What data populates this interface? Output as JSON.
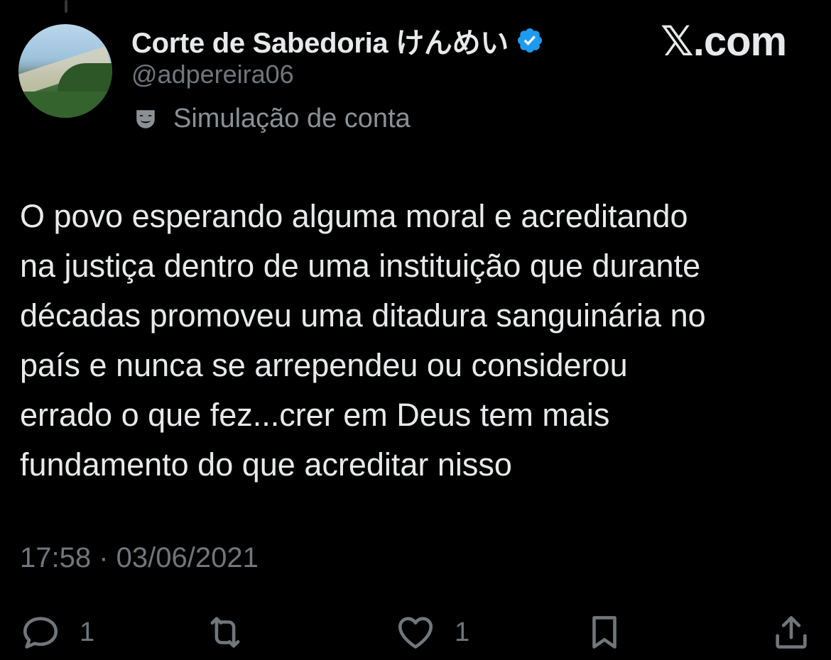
{
  "author": {
    "display_name": "Corte de Sabedoria けんめい",
    "handle": "@adpereira06",
    "parody_label": "Simulação de conta",
    "verified": true,
    "verified_color": "#1d9bf0"
  },
  "watermark": "𝕏.com",
  "tweet": {
    "lines": [
      "O povo esperando alguma moral e acreditando",
      "na justiça dentro de uma instituição que durante",
      "décadas promoveu uma ditadura sanguinária no",
      "país e nunca se arrependeu ou considerou",
      "errado o que fez...crer em Deus tem mais",
      "fundamento do que acreditar nisso"
    ],
    "timestamp": "17:58 · 03/06/2021"
  },
  "actions": {
    "reply": {
      "icon": "reply-icon",
      "count": "1"
    },
    "retweet": {
      "icon": "retweet-icon",
      "count": ""
    },
    "like": {
      "icon": "heart-icon",
      "count": "1"
    },
    "bookmark": {
      "icon": "bookmark-icon",
      "count": ""
    },
    "share": {
      "icon": "share-icon",
      "count": ""
    }
  },
  "colors": {
    "background": "#000000",
    "text_primary": "#e7e9ea",
    "text_secondary": "#71767b"
  }
}
